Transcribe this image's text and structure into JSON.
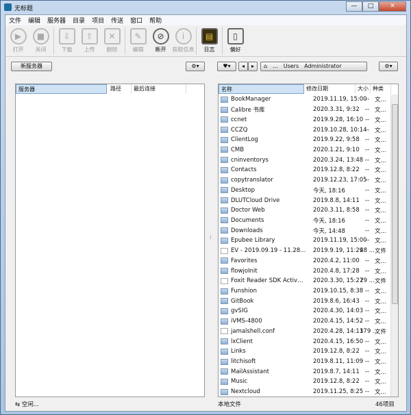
{
  "window": {
    "title": "无标题",
    "min": "—",
    "max": "□",
    "close": "✕"
  },
  "menu": [
    "文件",
    "编辑",
    "服务器",
    "目录",
    "项目",
    "传送",
    "窗口",
    "帮助"
  ],
  "toolbar": [
    {
      "label": "打开",
      "icon": "play-icon",
      "glyph": "▶",
      "enabled": false
    },
    {
      "label": "关闭",
      "icon": "stop-icon",
      "glyph": "■",
      "enabled": false
    },
    {
      "label": "下载",
      "icon": "download-icon",
      "glyph": "⇩",
      "enabled": false
    },
    {
      "label": "上传",
      "icon": "upload-icon",
      "glyph": "⇧",
      "enabled": false
    },
    {
      "label": "删除",
      "icon": "delete-icon",
      "glyph": "✕",
      "enabled": false
    },
    {
      "label": "编辑",
      "icon": "edit-icon",
      "glyph": "✎",
      "enabled": false
    },
    {
      "label": "断开",
      "icon": "disconnect-icon",
      "glyph": "⊘",
      "enabled": true
    },
    {
      "label": "获取信息",
      "icon": "info-icon",
      "glyph": "i",
      "enabled": false
    },
    {
      "label": "日志",
      "icon": "log-icon",
      "glyph": "▤",
      "enabled": true
    },
    {
      "label": "偏好",
      "icon": "preferences-icon",
      "glyph": "▯",
      "enabled": true
    }
  ],
  "nav": {
    "new_server": "新服务器",
    "gear": "⚙▾",
    "fav": "♥▾",
    "back": "◂",
    "fwd": "▸",
    "home": "⌂",
    "crumbs": [
      "...",
      "Users",
      "Administrator"
    ]
  },
  "left": {
    "headers": [
      "服务器",
      "路径",
      "最后连接"
    ],
    "status": "空闲..."
  },
  "right": {
    "headers": [
      "名称",
      "修改日期",
      "大小",
      "种类"
    ],
    "status_left": "本地文件",
    "status_right": "46项目",
    "rows": [
      [
        "BookManager",
        "2019.11.19, 15:00",
        "--",
        "文...",
        "d"
      ],
      [
        "Calibre 书库",
        "2020.3.31, 9:32",
        "--",
        "文...",
        "d"
      ],
      [
        "ccnet",
        "2019.9.28, 16:10",
        "--",
        "文...",
        "d"
      ],
      [
        "CCZQ",
        "2019.10.28, 10:14",
        "--",
        "文...",
        "d"
      ],
      [
        "ClientLog",
        "2019.9.22, 9:58",
        "--",
        "文...",
        "d"
      ],
      [
        "CMB",
        "2020.1.21, 9:10",
        "--",
        "文...",
        "d"
      ],
      [
        "cninventorys",
        "2020.3.24, 13:48",
        "--",
        "文...",
        "d"
      ],
      [
        "Contacts",
        "2019.12.8, 8:22",
        "--",
        "文...",
        "d"
      ],
      [
        "copytranslator",
        "2019.12.23, 17:05",
        "--",
        "文...",
        "d"
      ],
      [
        "Desktop",
        "今天, 18:16",
        "--",
        "文...",
        "d"
      ],
      [
        "DLUTCloud Drive",
        "2019.8.8, 14:11",
        "--",
        "文...",
        "d"
      ],
      [
        "Doctor Web",
        "2020.3.11, 8:58",
        "--",
        "文...",
        "d"
      ],
      [
        "Documents",
        "今天, 18:16",
        "--",
        "文...",
        "d"
      ],
      [
        "Downloads",
        "今天, 14:48",
        "--",
        "文...",
        "d"
      ],
      [
        "Epubee Library",
        "2019.11.19, 15:00",
        "--",
        "文...",
        "d"
      ],
      [
        "EV - 2019.09.19 - 11.28.58 ...",
        "2019.9.19, 11:29",
        "48 ...",
        "文件",
        "f"
      ],
      [
        "Favorites",
        "2020.4.2, 11:00",
        "--",
        "文...",
        "d"
      ],
      [
        "flowjoInit",
        "2020.4.8, 17:28",
        "--",
        "文...",
        "d"
      ],
      [
        "Foxit Reader SDK ActiveX...",
        "2020.3.30, 15:27",
        "29 ...",
        "文件",
        "f"
      ],
      [
        "Funshion",
        "2019.10.15, 8:38",
        "--",
        "文...",
        "d"
      ],
      [
        "GitBook",
        "2019.8.6, 16:43",
        "--",
        "文...",
        "d"
      ],
      [
        "gvSIG",
        "2020.4.30, 14:03",
        "--",
        "文...",
        "d"
      ],
      [
        "iVMS-4800",
        "2020.4.15, 14:52",
        "--",
        "文...",
        "d"
      ],
      [
        "jamalshell.conf",
        "2020.4.28, 14:11",
        "379 ...",
        "文件",
        "f"
      ],
      [
        "lxClient",
        "2020.4.15, 16:50",
        "--",
        "文...",
        "d"
      ],
      [
        "Links",
        "2019.12.8, 8:22",
        "--",
        "文...",
        "d"
      ],
      [
        "litchisoft",
        "2019.8.11, 11:09",
        "--",
        "文...",
        "d"
      ],
      [
        "MailAssistant",
        "2019.8.7, 14:11",
        "--",
        "文...",
        "d"
      ],
      [
        "Music",
        "2019.12.8, 8:22",
        "--",
        "文...",
        "d"
      ],
      [
        "Nextcloud",
        "2019.11.25, 8:25",
        "--",
        "文...",
        "d"
      ]
    ]
  }
}
